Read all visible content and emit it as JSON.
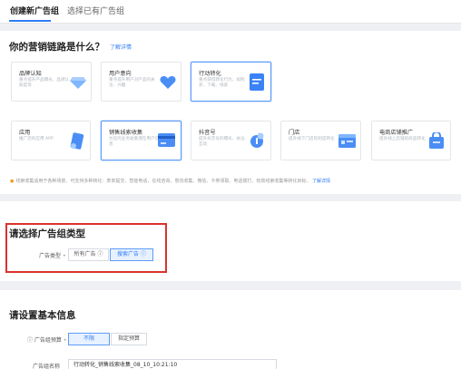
{
  "tabs": [
    {
      "label": "创建新广告组"
    },
    {
      "label": "选择已有广告组"
    }
  ],
  "marketing": {
    "title": "你的营销链路是什么？",
    "detail_link": "了解详情",
    "row1": [
      {
        "title": "品牌认知",
        "desc": "重点提升产品曝光、品牌认知度等",
        "icon": "diamond-icon",
        "selected": false
      },
      {
        "title": "用户意向",
        "desc": "重点提升用户对产品的关注、兴趣",
        "icon": "heart-icon",
        "selected": false
      },
      {
        "title": "行动转化",
        "desc": "重点获得转化行为，如购买、下载、线索",
        "icon": "document-icon",
        "selected": true
      }
    ],
    "row2": [
      {
        "title": "应用",
        "desc": "推广您的应用 APP",
        "icon": "app-icon",
        "selected": false
      },
      {
        "title": "销售线索收集",
        "desc": "为您的业务收集潜在用户信息",
        "icon": "card-icon",
        "selected": true
      },
      {
        "title": "抖音号",
        "desc": "提升抖音号的曝光、关注、互动",
        "icon": "douyin-icon",
        "selected": false
      },
      {
        "title": "门店",
        "desc": "提升线下门店的到店转化",
        "icon": "store-icon",
        "selected": false
      },
      {
        "title": "电商店铺推广",
        "desc": "提升线上店铺的商品转化",
        "icon": "shop-icon",
        "selected": false
      }
    ],
    "note": "线索收集适用于各种场景、可支持多种转化：表单提交、智能电话、在线咨询、意向收集、微信、卡券领取、电话拨打、有效线索收集等转化目标。",
    "note_link": "了解详情"
  },
  "adgroup_type": {
    "title": "请选择广告组类型",
    "field_label": "广告类型",
    "options": [
      {
        "label": "所有广告 ⓘ",
        "active": false
      },
      {
        "label": "搜索广告 ⓘ",
        "active": true
      }
    ]
  },
  "basic_info": {
    "title": "请设置基本信息",
    "budget_label": "ⓘ 广告组预算",
    "budget_options": [
      {
        "label": "不限",
        "active": true
      },
      {
        "label": "指定预算",
        "active": false
      }
    ],
    "name_label": "广告组名称",
    "name_value": "行动转化_销售线索收集_08_10_10:21:10"
  },
  "colors": {
    "accent": "#2f7cf6",
    "highlight_border": "#d9322e",
    "warning": "#f29b38"
  }
}
